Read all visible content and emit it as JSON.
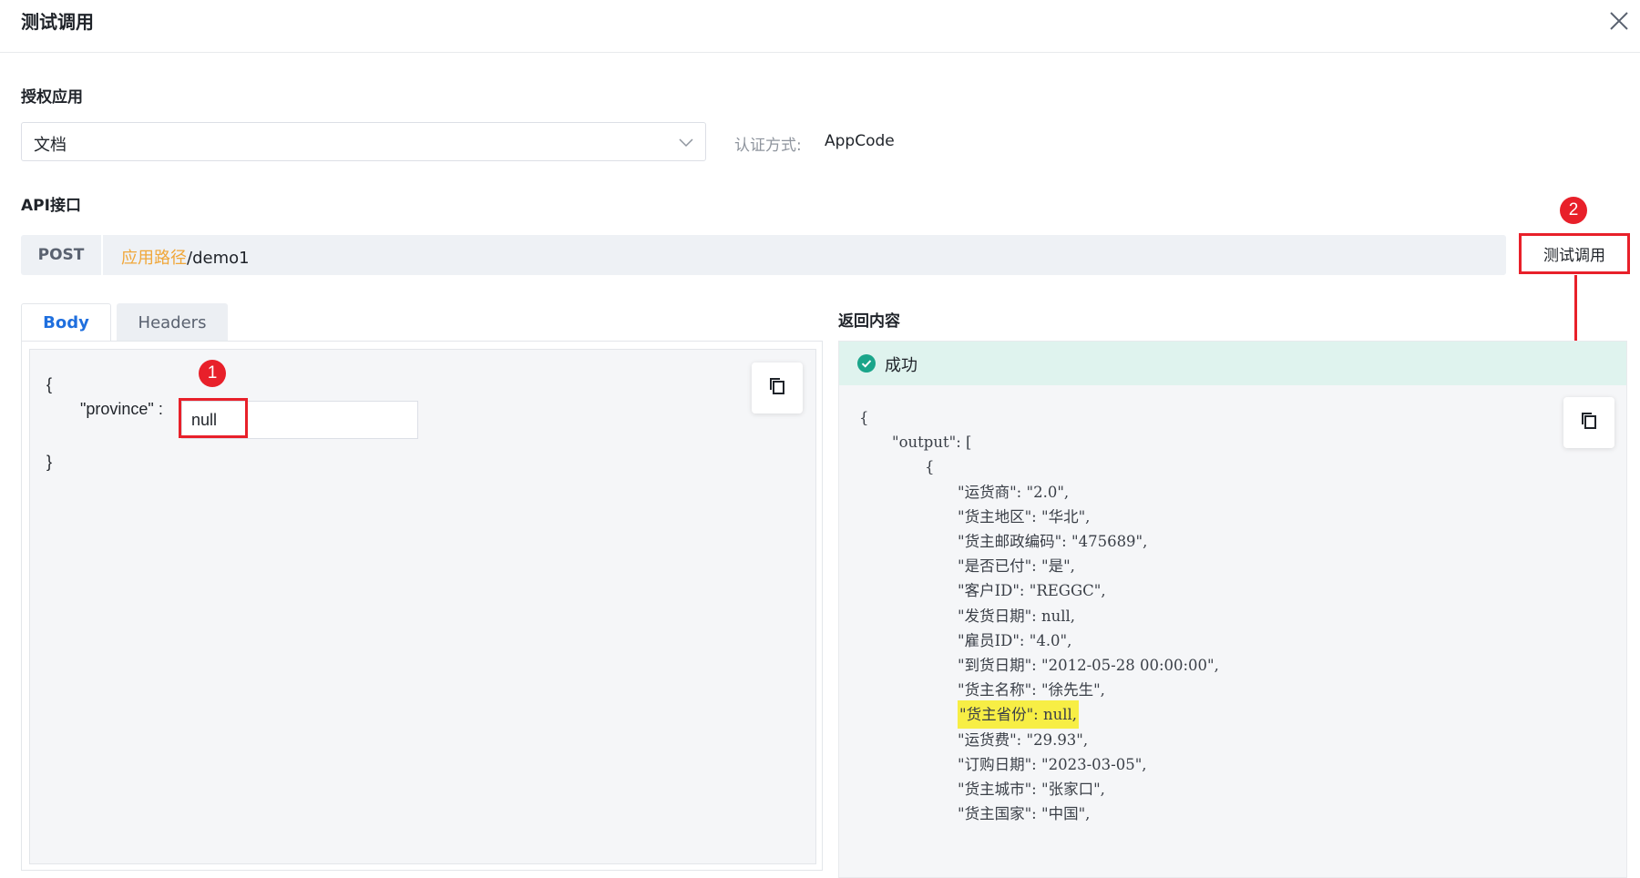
{
  "dialog": {
    "title": "测试调用"
  },
  "authorized_app": {
    "label": "授权应用",
    "selected": "文档",
    "auth_label": "认证方式:",
    "auth_value": "AppCode"
  },
  "api": {
    "label": "API接口",
    "method": "POST",
    "path_var": "应用路径",
    "path_rest": "/demo1",
    "test_button": "测试调用"
  },
  "annotations": {
    "badge1": "1",
    "badge2": "2"
  },
  "request": {
    "tabs": [
      {
        "label": "Body"
      },
      {
        "label": "Headers"
      }
    ],
    "open_brace": "{",
    "key": "\"province\" :",
    "value": "null",
    "close_brace": "}"
  },
  "response": {
    "label": "返回内容",
    "status": "成功",
    "lines": [
      "{",
      "\"output\": [",
      "{",
      "\"运货商\": \"2.0\",",
      "\"货主地区\": \"华北\",",
      "\"货主邮政编码\": \"475689\",",
      "\"是否已付\": \"是\",",
      "\"客户ID\": \"REGGC\",",
      "\"发货日期\": null,",
      "\"雇员ID\": \"4.0\",",
      "\"到货日期\": \"2012-05-28 00:00:00\",",
      "\"货主名称\": \"徐先生\",",
      "\"货主省份\": null,",
      "\"运货费\": \"29.93\",",
      "\"订购日期\": \"2023-03-05\",",
      "\"货主城市\": \"张家口\",",
      "\"货主国家\": \"中国\","
    ]
  },
  "colors": {
    "accent_red": "#e8202a",
    "tab_active": "#1f6fde",
    "path_var": "#f0a73a",
    "success_bg": "#dff3ee",
    "success_icon": "#1aa58a",
    "highlight": "#f7ee45"
  }
}
